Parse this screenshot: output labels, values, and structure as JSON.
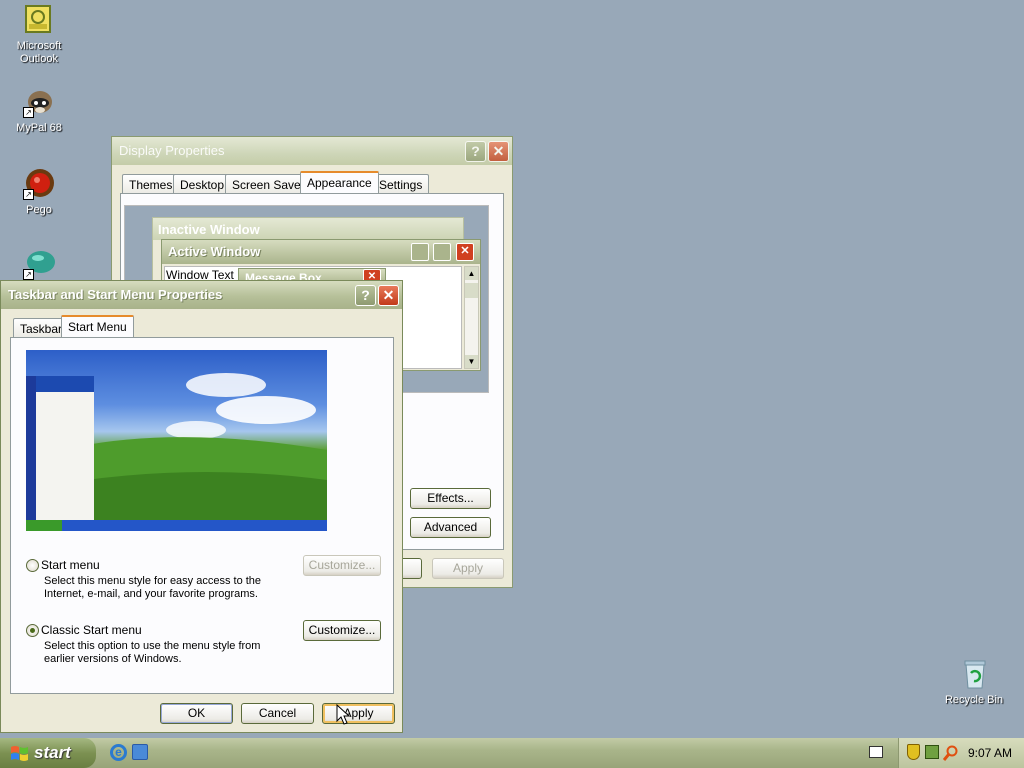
{
  "desktop": {
    "icons": [
      {
        "name": "outlook",
        "label": "Microsoft Outlook"
      },
      {
        "name": "mypal",
        "label": "MyPal 68"
      },
      {
        "name": "pego",
        "label": "Pego"
      },
      {
        "name": "app4",
        "label": ""
      },
      {
        "name": "recycle",
        "label": "Recycle Bin"
      }
    ]
  },
  "display_properties": {
    "title": "Display Properties",
    "tabs": [
      "Themes",
      "Desktop",
      "Screen Saver",
      "Appearance",
      "Settings"
    ],
    "active_tab": "Appearance",
    "preview": {
      "inactive_title": "Inactive Window",
      "active_title": "Active Window",
      "window_text": "Window Text",
      "message_box": "Message Box"
    },
    "effects_label": "Effects...",
    "advanced_label": "Advanced",
    "apply_label": "Apply"
  },
  "taskbar_props": {
    "title": "Taskbar and Start Menu Properties",
    "tabs": [
      "Taskbar",
      "Start Menu"
    ],
    "active_tab": "Start Menu",
    "start_menu_option": {
      "label": "Start menu",
      "description": "Select this menu style for easy access to the Internet, e-mail, and your favorite programs.",
      "customize": "Customize...",
      "selected": false
    },
    "classic_option": {
      "label": "Classic Start menu",
      "description": "Select this option to use the menu style from earlier versions of Windows.",
      "customize": "Customize...",
      "selected": true
    },
    "ok_label": "OK",
    "cancel_label": "Cancel",
    "apply_label": "Apply"
  },
  "taskbar": {
    "start_label": "start",
    "clock": "9:07 AM"
  },
  "colors": {
    "accent": "#e68b2c",
    "close": "#c23a1a",
    "title_olive": "#b6c099"
  }
}
